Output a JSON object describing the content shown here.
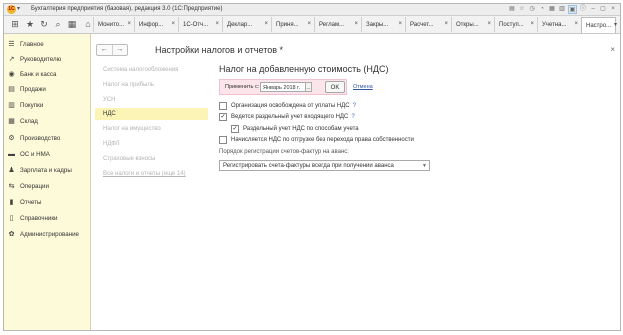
{
  "window": {
    "title": "Бухгалтерия предприятия (базовая), редакция 3.0  (1С:Предприятие)",
    "logo_text": "1С"
  },
  "tabs": [
    {
      "label": "Монито..."
    },
    {
      "label": "Инфор..."
    },
    {
      "label": "1С-Отч..."
    },
    {
      "label": "Деклар..."
    },
    {
      "label": "Приня..."
    },
    {
      "label": "Реглам..."
    },
    {
      "label": "Закры..."
    },
    {
      "label": "Расчет..."
    },
    {
      "label": "Откры..."
    },
    {
      "label": "Поступ..."
    },
    {
      "label": "Учетна..."
    },
    {
      "label": "Настро..."
    }
  ],
  "tab_close": "×",
  "sidebar": {
    "items": [
      {
        "label": "Главное",
        "icon": "☰"
      },
      {
        "label": "Руководителю",
        "icon": "↗"
      },
      {
        "label": "Банк и касса",
        "icon": "◉"
      },
      {
        "label": "Продажи",
        "icon": "▤"
      },
      {
        "label": "Покупки",
        "icon": "▥"
      },
      {
        "label": "Склад",
        "icon": "▦"
      },
      {
        "label": "Производство",
        "icon": "⚙"
      },
      {
        "label": "ОС и НМА",
        "icon": "▬"
      },
      {
        "label": "Зарплата и кадры",
        "icon": "♟"
      },
      {
        "label": "Операции",
        "icon": "⇆"
      },
      {
        "label": "Отчеты",
        "icon": "▮"
      },
      {
        "label": "Справочники",
        "icon": "▯"
      },
      {
        "label": "Администрирование",
        "icon": "✿"
      }
    ]
  },
  "content": {
    "page_title": "Настройки налогов и отчетов *",
    "close": "×",
    "nav_back": "←",
    "nav_forward": "→"
  },
  "left_list": [
    {
      "label": "Система налогообложения",
      "active": false
    },
    {
      "label": "Налог на прибыль",
      "active": false
    },
    {
      "label": "УСН",
      "active": false
    },
    {
      "label": "НДС",
      "active": true
    },
    {
      "label": "Налог на имущество",
      "active": false
    },
    {
      "label": "НДФЛ",
      "active": false
    },
    {
      "label": "Страховые взносы",
      "active": false
    },
    {
      "label": "Все налоги и отчеты (еще 14)",
      "active": false
    }
  ],
  "vat": {
    "section_title": "Налог на добавленную стоимость (НДС)",
    "apply_label": "Применить с:",
    "apply_value": "Январь 2018 г.",
    "date_btn": "...",
    "ok_label": "OK",
    "cancel_label": "Отмена",
    "options": [
      {
        "label": "Организация освобождена от уплаты НДС",
        "checked": false,
        "help": "?"
      },
      {
        "label": "Ведется раздельный учет входящего НДС",
        "checked": true,
        "help": "?"
      },
      {
        "label": "Раздельный учет НДС по способам учета",
        "checked": true,
        "help": ""
      },
      {
        "label": "Начисляется НДС по отгрузке без перехода права собственности",
        "checked": false,
        "help": ""
      }
    ],
    "order_label": "Порядок регистрации счетов-фактур на аванс:",
    "order_value": "Регистрировать счета-фактуры всегда при получении аванса",
    "order_arrow": "▼"
  }
}
